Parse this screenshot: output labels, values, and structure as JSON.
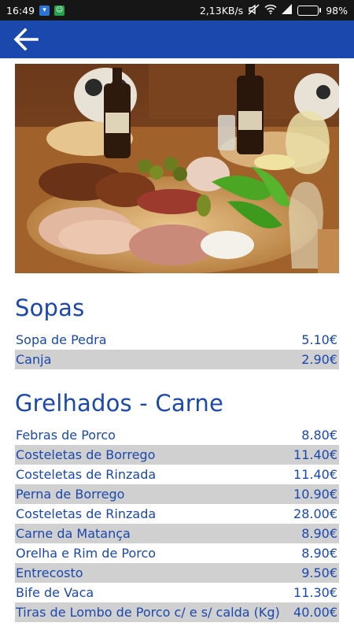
{
  "status_bar": {
    "time": "16:49",
    "network_speed": "2,13KB/s",
    "battery": "98%",
    "battery_level": 0.98,
    "icons": [
      "vpn-icon",
      "app-notification-icon",
      "mute-icon",
      "wifi-icon",
      "signal-icon",
      "battery-icon"
    ]
  },
  "app_bar": {
    "background": "#1b48ad",
    "back_icon": "arrow-left-icon"
  },
  "colors": {
    "accent": "#1b48ad",
    "row_stripe": "#d0d0d0"
  },
  "menu": {
    "sections": [
      {
        "title": "Sopas",
        "items": [
          {
            "name": "Sopa de Pedra",
            "price": "5.10€"
          },
          {
            "name": "Canja",
            "price": "2.90€"
          }
        ]
      },
      {
        "title": "Grelhados - Carne",
        "items": [
          {
            "name": "Febras de Porco",
            "price": "8.80€"
          },
          {
            "name": "Costeletas de Borrego",
            "price": "11.40€"
          },
          {
            "name": "Costeletas de Rinzada",
            "price": "11.40€"
          },
          {
            "name": "Perna de Borrego",
            "price": "10.90€"
          },
          {
            "name": "Costeletas de Rinzada",
            "price": "28.00€"
          },
          {
            "name": "Carne da Matança",
            "price": "8.90€"
          },
          {
            "name": "Orelha e Rim de Porco",
            "price": "8.90€"
          },
          {
            "name": "Entrecosto",
            "price": "9.50€"
          },
          {
            "name": "Bife de Vaca",
            "price": "11.30€"
          },
          {
            "name": "Tiras de Lombo de Porco c/ e s/ calda (Kg)",
            "price": "40.00€"
          }
        ]
      }
    ]
  }
}
